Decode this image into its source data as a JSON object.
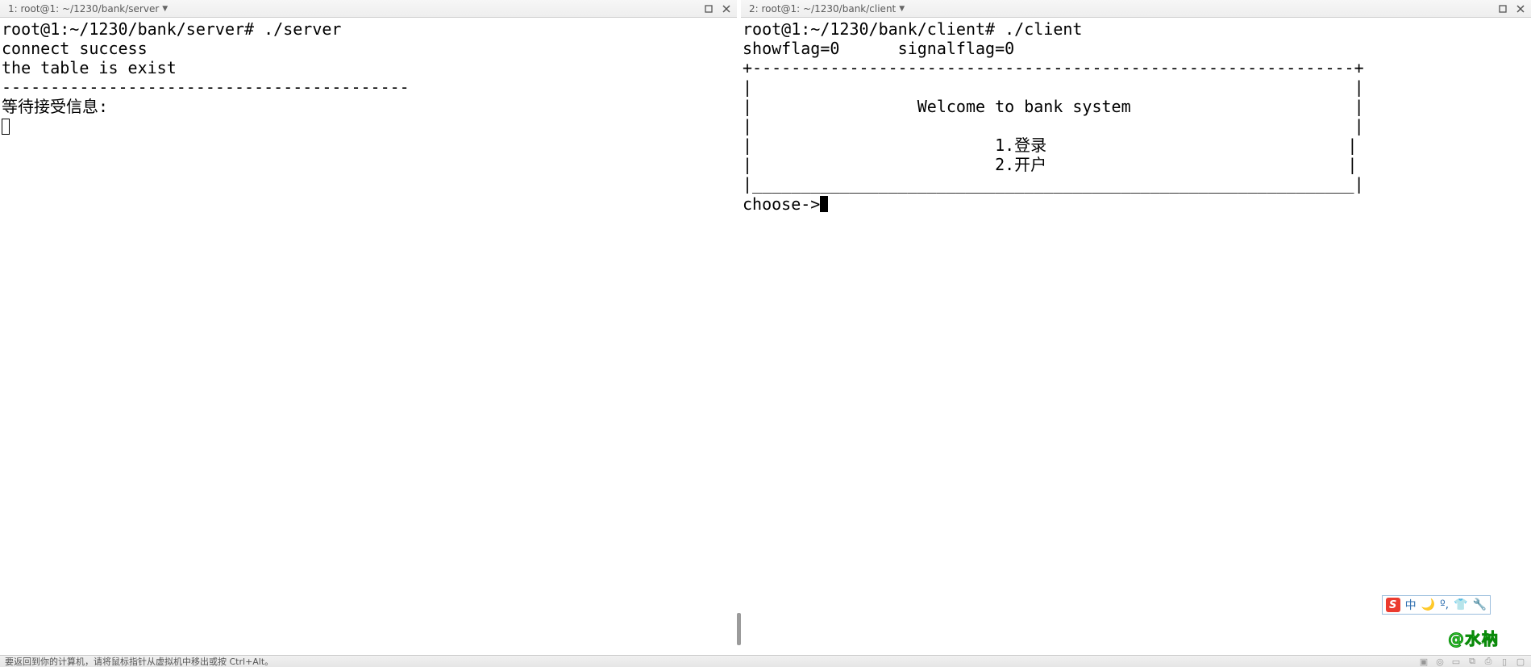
{
  "left": {
    "title": "1: root@1: ~/1230/bank/server",
    "lines": {
      "l0": "root@1:~/1230/bank/server# ./server",
      "l1": "connect success",
      "l2": "the table is exist",
      "l3": "------------------------------------------",
      "l4": "等待接受信息:"
    }
  },
  "right": {
    "title": "2: root@1: ~/1230/bank/client",
    "lines": {
      "l0": "root@1:~/1230/bank/client# ./client",
      "l1": "showflag=0      signalflag=0",
      "l2": "+--------------------------------------------------------------+",
      "l3": "|                                                              |",
      "l4": "|                 Welcome to bank system                       |",
      "l5": "|                                                              |",
      "l6": "|                         1.登录                               |",
      "l7": "|                         2.开户                               |",
      "l8": "|______________________________________________________________|",
      "l9": "choose->"
    }
  },
  "hostbar": {
    "text": "要返回到你的计算机，请将鼠标指针从虚拟机中移出或按 Ctrl+Alt。"
  },
  "ime": {
    "badge": "S",
    "g1": "中",
    "g2": "🌙",
    "g3": "º,",
    "g4": "👕",
    "g5": "🔧"
  },
  "watermark": "@水枘"
}
